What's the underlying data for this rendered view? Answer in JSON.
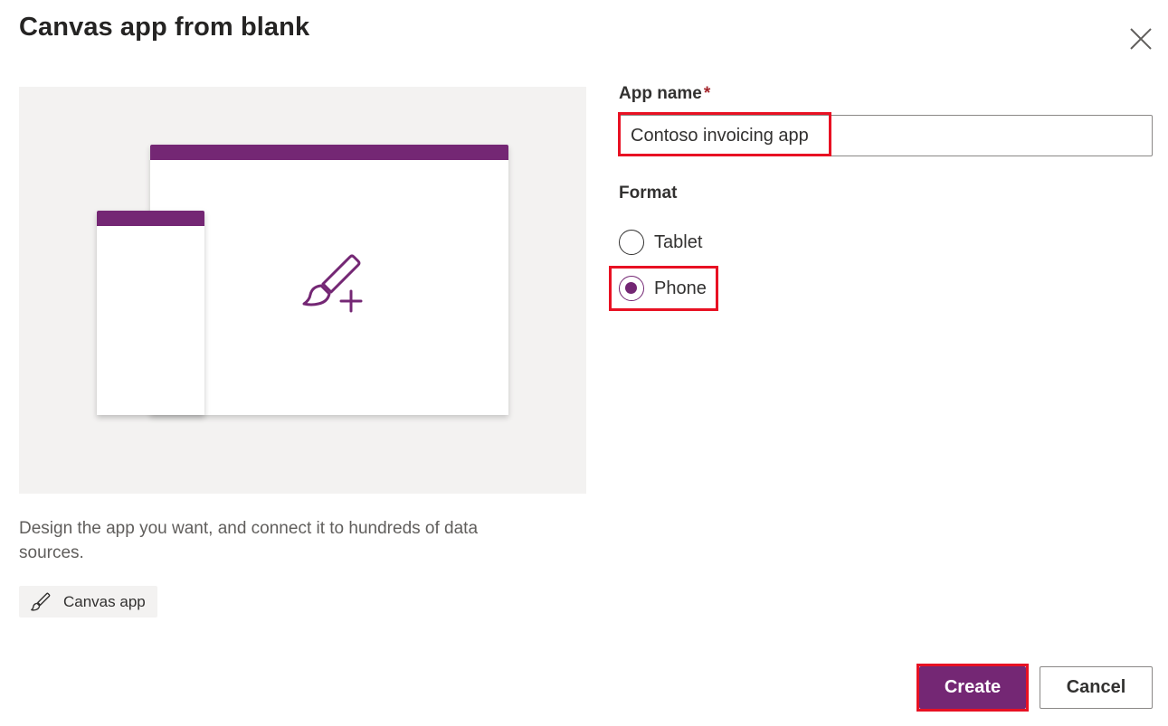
{
  "dialog": {
    "title": "Canvas app from blank",
    "close_icon": "close-icon"
  },
  "preview": {
    "accent_color": "#742774",
    "background_color": "#f3f2f1",
    "center_icon": "brush-plus-icon"
  },
  "description": "Design the app you want, and connect it to hundreds of data sources.",
  "tag": {
    "icon": "brush-icon",
    "label": "Canvas app"
  },
  "form": {
    "app_name_label": "App name",
    "required_marker": "*",
    "app_name_value": "Contoso invoicing app",
    "format_label": "Format",
    "format_options": [
      {
        "label": "Tablet",
        "selected": false
      },
      {
        "label": "Phone",
        "selected": true
      }
    ]
  },
  "buttons": {
    "create_label": "Create",
    "cancel_label": "Cancel",
    "primary_color": "#742774"
  },
  "annotations": {
    "highlight_color": "#e81123"
  }
}
